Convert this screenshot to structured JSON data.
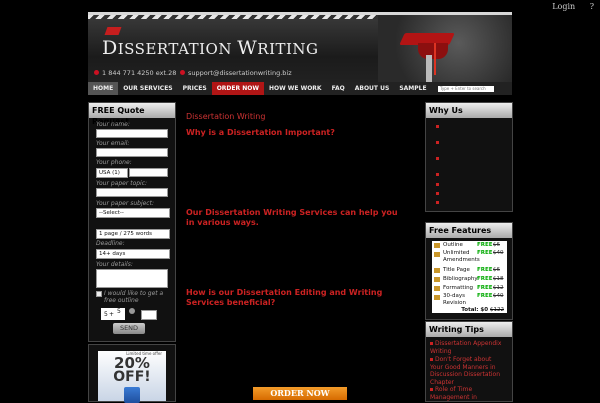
{
  "toplinks": {
    "login": "Login",
    "help": "?"
  },
  "header": {
    "logo_first": "D",
    "logo_rest1": "ISSERTATION ",
    "logo_w": "W",
    "logo_rest2": "RITING",
    "phone": "1 844 771 4250 ext.28",
    "email": "support@dissertationwriting.biz"
  },
  "nav": {
    "items": [
      "HOME",
      "OUR SERVICES",
      "PRICES",
      "ORDER NOW",
      "HOW WE WORK",
      "FAQ",
      "ABOUT US",
      "SAMPLE"
    ],
    "search_placeholder": "Type + Enter to search"
  },
  "quote": {
    "title": "FREE Quote Request",
    "name_label": "Your name:",
    "email_label": "Your email:",
    "phone_label": "Your phone:",
    "country": "USA (1)",
    "topic_label": "Your paper topic:",
    "subject_label": "Your paper subject:",
    "subject": "--Select--",
    "pages": "1 page / 275 words",
    "deadline_label": "Deadline:",
    "deadline": "14+ days",
    "details_label": "Your details:",
    "checkbox_text": "I would like to get a free outline",
    "captcha_a": "5",
    "captcha_b": "5",
    "send": "SEND"
  },
  "promo": {
    "top": "Limited time offer",
    "big": "20%",
    "off": "OFF!"
  },
  "main": {
    "title": "Dissertation Writing",
    "h1": "Why is a Dissertation Important?",
    "h2": "Our Dissertation Writing Services can help you in various ways.",
    "h3": "How is our  Dissertation Editing and Writing Services beneficial?",
    "order": "ORDER NOW"
  },
  "why": {
    "title": "Why Us"
  },
  "features": {
    "title": "Free Features",
    "rows": [
      {
        "name": "Outline",
        "free": "FREE",
        "price": "$6"
      },
      {
        "name": "Unlimited Amendments",
        "free": "FREE",
        "price": "$40"
      },
      {
        "name": "Title Page",
        "free": "FREE",
        "price": "$6"
      },
      {
        "name": "Bibliography",
        "free": "FREE",
        "price": "$18"
      },
      {
        "name": "Formatting",
        "free": "FREE",
        "price": "$12"
      },
      {
        "name": "30-days Revision",
        "free": "FREE",
        "price": "$40"
      }
    ],
    "total_label": "Total: $0",
    "total_old": "$122"
  },
  "tips": {
    "title": "Writing Tips",
    "items": [
      "Dissertation Appendix Writing",
      "Don't Forget about Your Good Manners in Discussion Dissertation Chapter",
      "Role of Time Management in"
    ]
  }
}
